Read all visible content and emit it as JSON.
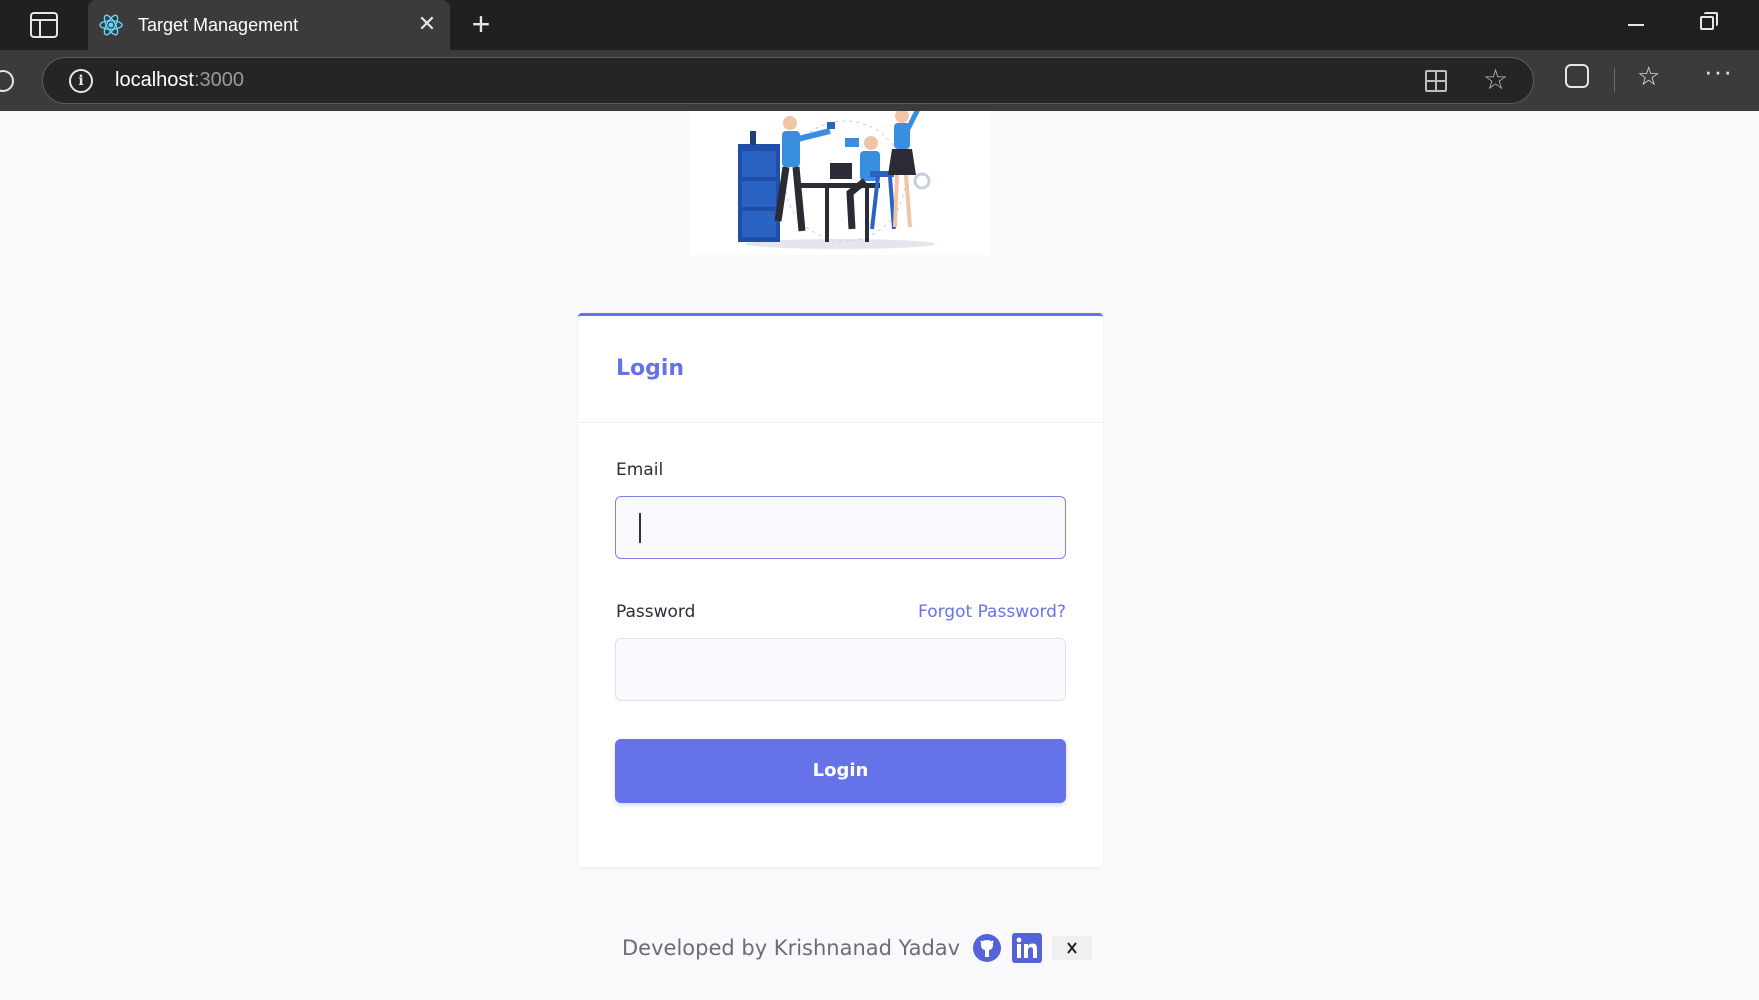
{
  "browser": {
    "tab_title": "Target Management",
    "url_host": "localhost",
    "url_port": ":3000",
    "icons": [
      "tab-actions-icon",
      "react-favicon-icon",
      "close-icon",
      "plus-icon",
      "minimize-icon",
      "restore-icon",
      "reload-icon",
      "info-icon",
      "split-screen-icon",
      "star-icon",
      "extensions-icon",
      "favorites-icon",
      "more-icon"
    ]
  },
  "login": {
    "title": "Login",
    "email_label": "Email",
    "email_value": "",
    "password_label": "Password",
    "password_value": "",
    "forgot_label": "Forgot Password?",
    "submit_label": "Login"
  },
  "footer": {
    "text": "Developed by Krishnanad Yadav",
    "links": [
      "github-icon",
      "linkedin-icon",
      "x-icon"
    ]
  },
  "colors": {
    "accent": "#6673e8",
    "page_bg": "#f9f9fb",
    "chrome_dark": "#202020",
    "chrome_toolbar": "#3b3b3b"
  }
}
